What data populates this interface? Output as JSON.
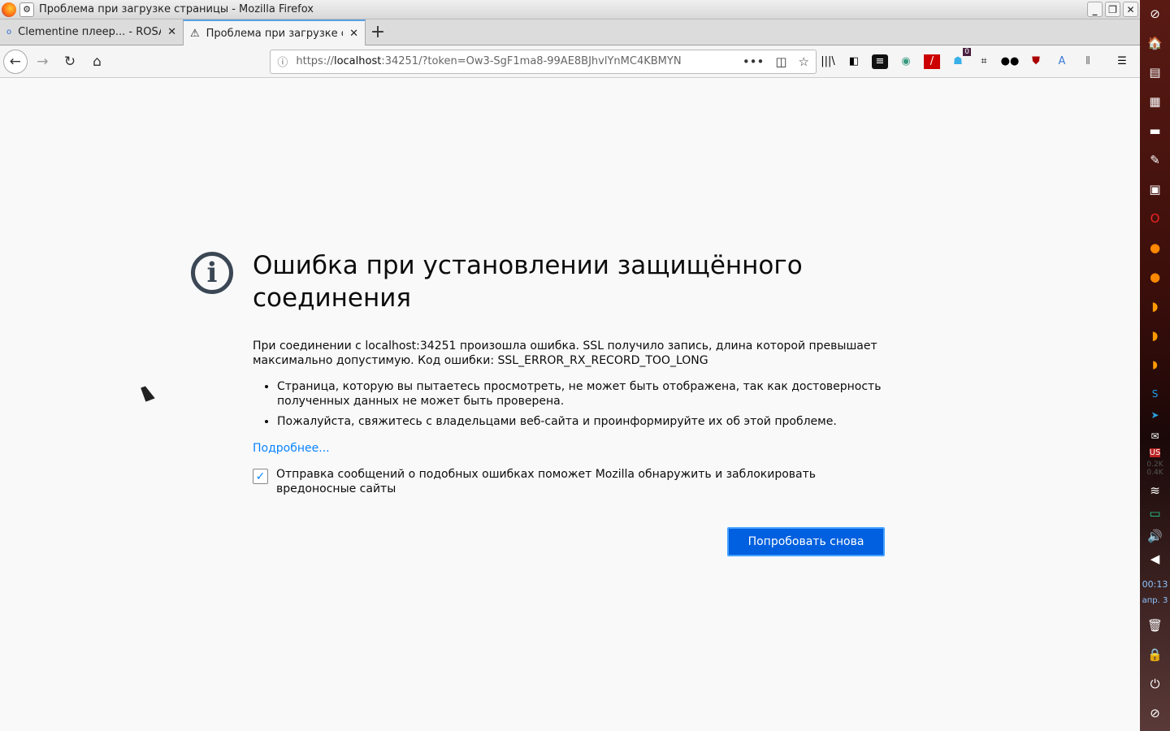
{
  "window": {
    "title": "Проблема при загрузке страницы - Mozilla Firefox"
  },
  "tabs": [
    {
      "label": "Clementine плеер... - ROSA"
    },
    {
      "label": "Проблема при загрузке ст"
    }
  ],
  "url": {
    "scheme": "https://",
    "host": "localhost",
    "rest": ":34251/?token=Ow3-SgF1ma8-99AE8BJhvlYnMC4KBMYN"
  },
  "toolbar": {
    "badge": "0"
  },
  "error": {
    "title": "Ошибка при установлении защищённого соединения",
    "description": "При соединении с localhost:34251 произошла ошибка. SSL получило запись, длина которой превышает максимально допустимую. Код ошибки: SSL_ERROR_RX_RECORD_TOO_LONG",
    "bullets": [
      "Страница, которую вы пытаетесь просмотреть, не может быть отображена, так как достоверность полученных данных не может быть проверена.",
      "Пожалуйста, свяжитесь с владельцами веб-сайта и проинформируйте их об этой проблеме."
    ],
    "more_link": "Подробнее...",
    "report_label": "Отправка сообщений о подобных ошибках поможет Mozilla обнаружить и заблокировать вредоносные сайты",
    "report_checked": true,
    "retry_label": "Попробовать снова"
  },
  "panel": {
    "keyboard": "US",
    "net_up": "0.2K",
    "net_down": "0.4K",
    "time": "00:13",
    "date": "апр. 3"
  }
}
